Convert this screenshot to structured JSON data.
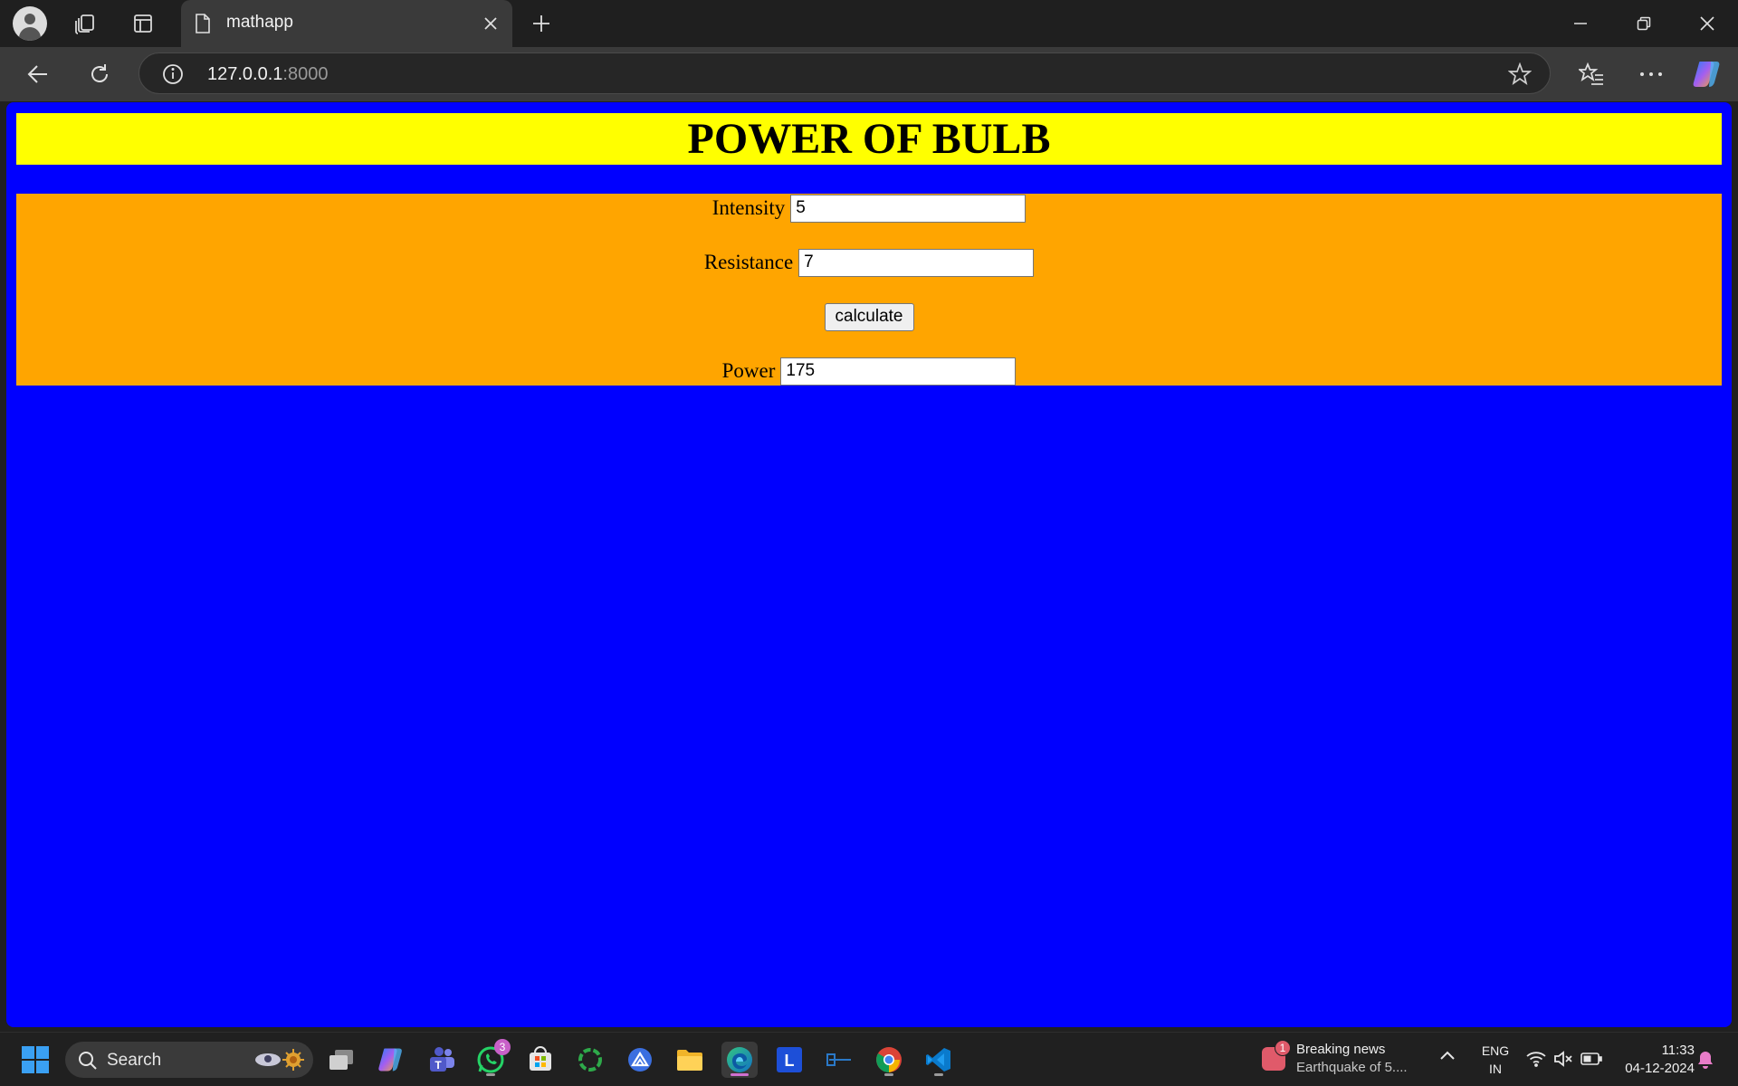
{
  "browser": {
    "tab_title": "mathapp",
    "url_host": "127.0.0.1",
    "url_port": ":8000"
  },
  "page": {
    "title": "POWER OF BULB",
    "fields": {
      "intensity_label": "Intensity",
      "intensity_value": "5",
      "resistance_label": "Resistance",
      "resistance_value": "7",
      "calculate_label": "calculate",
      "power_label": "Power",
      "power_value": "175"
    },
    "colors": {
      "background": "#0000ff",
      "header": "#ffff00",
      "form_panel": "#ffa500"
    }
  },
  "taskbar": {
    "search_label": "Search",
    "whatsapp_badge": "3",
    "news_badge": "1",
    "news_title": "Breaking news",
    "news_subtitle": "Earthquake of 5....",
    "language_line1": "ENG",
    "language_line2": "IN",
    "time": "11:33",
    "date": "04-12-2024"
  }
}
